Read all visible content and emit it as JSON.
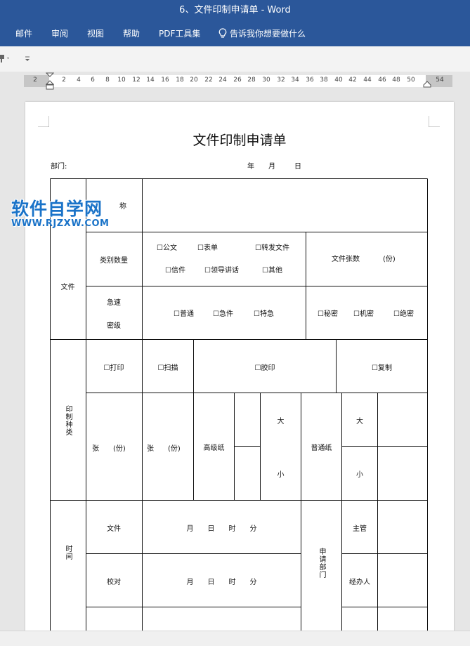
{
  "window": {
    "title": "6、文件印制申请单 - Word"
  },
  "menu": [
    {
      "label": "邮件"
    },
    {
      "label": "审阅"
    },
    {
      "label": "视图"
    },
    {
      "label": "帮助"
    },
    {
      "label": "PDF工具集"
    },
    {
      "label": "告诉我你想要做什么"
    }
  ],
  "ruler": {
    "ticks": [
      "2",
      "2",
      "4",
      "6",
      "8",
      "10",
      "12",
      "14",
      "16",
      "18",
      "20",
      "22",
      "24",
      "26",
      "28",
      "30",
      "32",
      "34",
      "36",
      "38",
      "40",
      "42",
      "44",
      "46",
      "48",
      "50",
      "54"
    ]
  },
  "doc": {
    "title": "文件印制申请单",
    "dept_label": "部门:",
    "year": "年",
    "month": "月",
    "day": "日"
  },
  "watermark": {
    "main": "软件自学网",
    "sub": "WWW.RJZXW.COM"
  },
  "table": {
    "name_label": "称",
    "file_label": "文件",
    "category_qty": "类别数量",
    "opt_gongwen": "☐公文",
    "opt_biaodan": "☐表单",
    "opt_zhuanfa": "☐转发文件",
    "opt_xinjian": "☐信件",
    "opt_lingdao": "☐领导讲话",
    "opt_qita": "☐其他",
    "sheet_count": "文件张数",
    "sheet_unit": "(份)",
    "urgency_1": "急速",
    "urgency_2": "密级",
    "opt_putong": "☐普通",
    "opt_jijian": "☐急件",
    "opt_teji": "☐特急",
    "opt_mimi": "☐秘密",
    "opt_jimi": "☐机密",
    "opt_juemi": "☐绝密",
    "print_type": "印制种类",
    "opt_dayin": "☐打印",
    "opt_saomiao": "☐扫描",
    "opt_jiaoyin": "☐胶印",
    "opt_fuzhi": "☐复制",
    "zhang_fen_1": "张　　(份)",
    "zhang_fen_2": "张　　(份)",
    "premium_paper": "高级纸",
    "big_1": "大",
    "small_1": "小",
    "normal_paper": "普通纸",
    "big_2": "大",
    "small_2": "小",
    "time_label": "时间",
    "row_file": "文件",
    "row_proof": "校对",
    "time_fmt_1": "月　　日　　时　　分",
    "time_fmt_2": "月　　日　　时　　分",
    "apply_dept": "申请部门",
    "supervisor": "主管",
    "handler": "经办人"
  }
}
